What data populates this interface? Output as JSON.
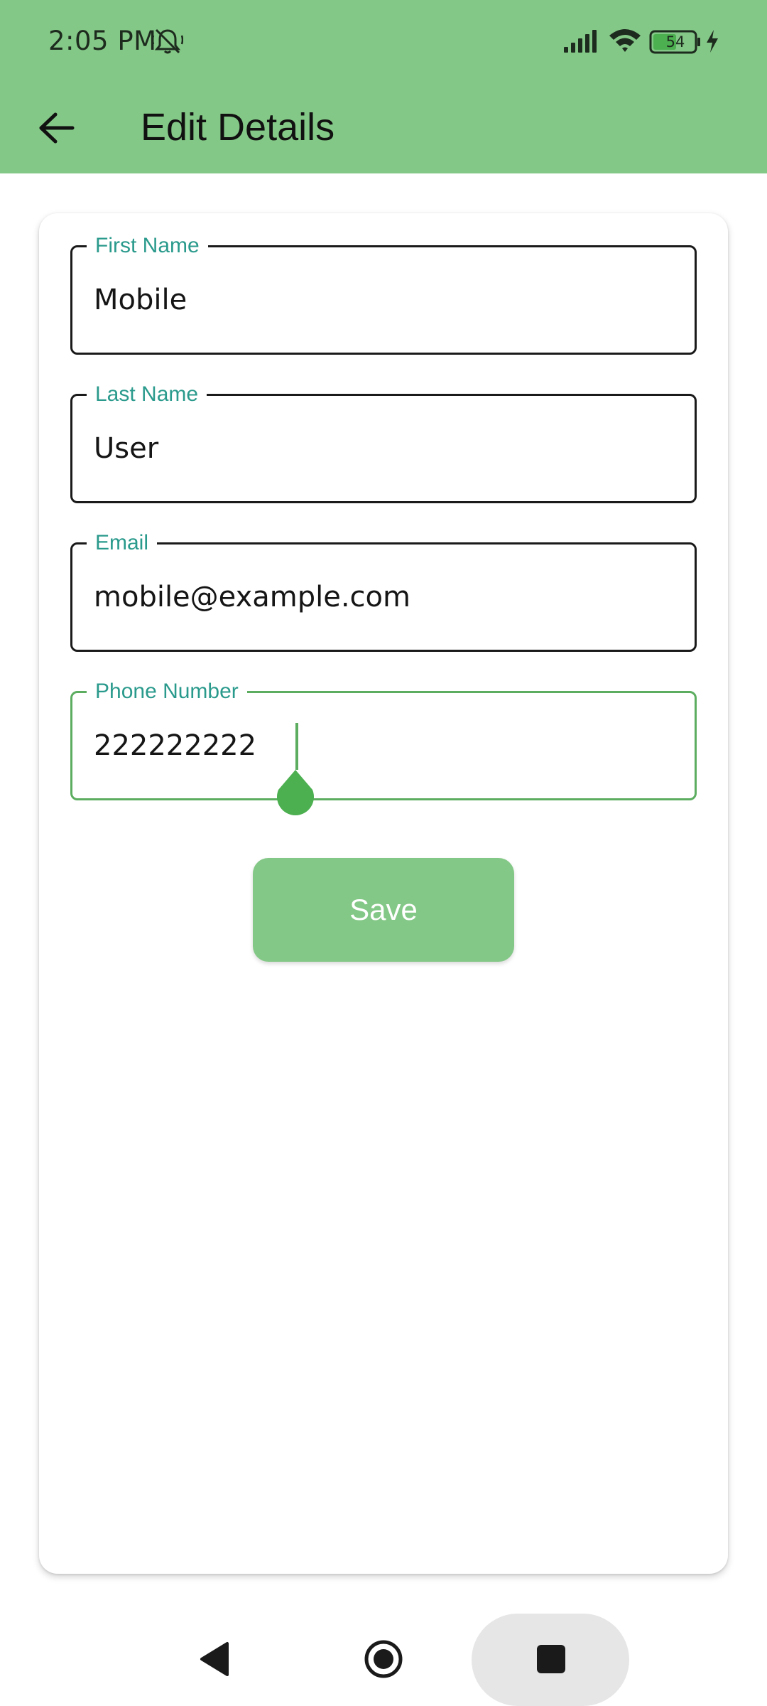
{
  "status_bar": {
    "time": "2:05 PM",
    "battery_level": "54",
    "icons": [
      "mute-icon",
      "signal-icon",
      "wifi-icon",
      "battery-icon",
      "charging-icon"
    ]
  },
  "toolbar": {
    "back_icon": "arrow-left-icon",
    "title": "Edit Details"
  },
  "form": {
    "first_name": {
      "label": "First Name",
      "value": "Mobile"
    },
    "last_name": {
      "label": "Last Name",
      "value": "User"
    },
    "email": {
      "label": "Email",
      "value": "mobile@example.com"
    },
    "phone": {
      "label": "Phone Number",
      "value": "222222222",
      "focused": true
    },
    "save_label": "Save"
  },
  "nav_bar": {
    "icons": [
      "nav-back-icon",
      "nav-home-icon",
      "nav-recent-icon"
    ]
  },
  "colors": {
    "primary": "#84c887",
    "label": "#2a9a8c",
    "focus": "#5cad60",
    "cursor_handle": "#4caf50"
  }
}
